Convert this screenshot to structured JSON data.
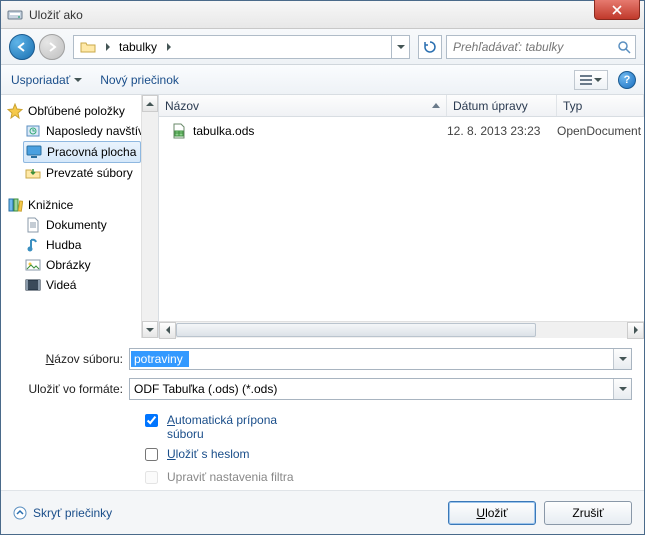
{
  "window": {
    "title": "Uložiť ako"
  },
  "nav": {
    "folder": "tabulky",
    "search_placeholder": "Prehľadávať: tabulky"
  },
  "toolbar": {
    "organize": "Usporiadať",
    "new_folder": "Nový priečinok"
  },
  "columns": {
    "name": "Názov",
    "modified": "Dátum úpravy",
    "type": "Typ"
  },
  "sidebar": {
    "favorites": {
      "label": "Obľúbené položky"
    },
    "recent": {
      "label": "Naposledy navštívené"
    },
    "desktop": {
      "label": "Pracovná plocha"
    },
    "downloads": {
      "label": "Prevzaté súbory"
    },
    "libraries": {
      "label": "Knižnice"
    },
    "documents": {
      "label": "Dokumenty"
    },
    "music": {
      "label": "Hudba"
    },
    "pictures": {
      "label": "Obrázky"
    },
    "videos": {
      "label": "Videá"
    }
  },
  "files": [
    {
      "name": "tabulka.ods",
      "modified": "12. 8. 2013 23:23",
      "type": "OpenDocument"
    }
  ],
  "form": {
    "filename_label": "Názov súboru:",
    "filename_value": "potraviny",
    "filetype_label": "Uložiť vo formáte:",
    "filetype_value": "ODF Tabuľka (.ods) (*.ods)",
    "auto_ext": "Automatická prípona súboru",
    "save_pw": "Uložiť s heslom",
    "edit_filter": "Upraviť nastavenia filtra"
  },
  "footer": {
    "hide_folders": "Skryť priečinky",
    "save": "Uložiť",
    "cancel": "Zrušiť"
  }
}
